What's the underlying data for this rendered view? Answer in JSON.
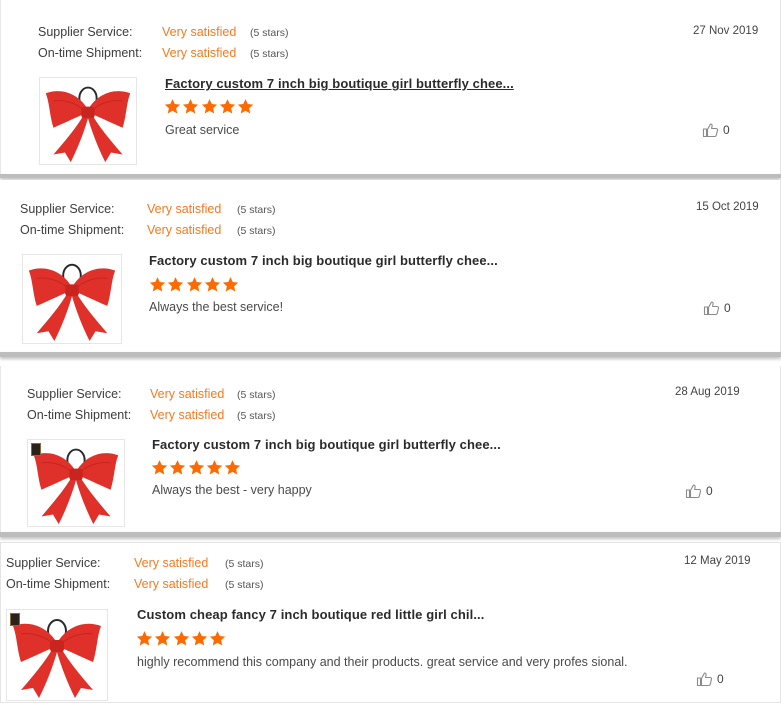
{
  "reviews": [
    {
      "supplier_label": "Supplier Service:",
      "supplier_value": "Very satisfied",
      "supplier_stars": "(5 stars)",
      "shipment_label": "On-time Shipment:",
      "shipment_value": "Very satisfied",
      "shipment_stars": "(5 stars)",
      "date": "27 Nov 2019",
      "product_title": "Factory custom 7 inch big boutique girl butterfly chee...",
      "rating": 5,
      "comment": "Great service",
      "likes": "0",
      "thumbnail_icon": "red-hair-bow-image"
    },
    {
      "supplier_label": "Supplier Service:",
      "supplier_value": "Very satisfied",
      "supplier_stars": "(5 stars)",
      "shipment_label": "On-time Shipment:",
      "shipment_value": "Very satisfied",
      "shipment_stars": "(5 stars)",
      "date": "15 Oct 2019",
      "product_title": "Factory custom 7 inch big boutique girl butterfly chee...",
      "rating": 5,
      "comment": "Always the best service!",
      "likes": "0",
      "thumbnail_icon": "red-hair-bow-image"
    },
    {
      "supplier_label": "Supplier Service:",
      "supplier_value": "Very satisfied",
      "supplier_stars": "(5 stars)",
      "shipment_label": "On-time Shipment:",
      "shipment_value": "Very satisfied",
      "shipment_stars": "(5 stars)",
      "date": "28 Aug 2019",
      "product_title": "Factory custom 7 inch big boutique girl butterfly chee...",
      "rating": 5,
      "comment": "Always the best - very happy",
      "likes": "0",
      "thumbnail_icon": "red-hair-bow-image"
    },
    {
      "supplier_label": "Supplier Service:",
      "supplier_value": "Very satisfied",
      "supplier_stars": "(5 stars)",
      "shipment_label": "On-time Shipment:",
      "shipment_value": "Very satisfied",
      "shipment_stars": "(5 stars)",
      "date": "12 May 2019",
      "product_title": "Custom cheap fancy 7 inch boutique red little girl chil...",
      "rating": 5,
      "comment": "highly recommend this company and their products. great service and very profes sional.",
      "likes": "0",
      "thumbnail_icon": "red-hair-bow-image"
    }
  ],
  "colors": {
    "accent_orange": "#f7791e",
    "star_orange": "#ff6a00",
    "bow_red": "#e0302a"
  }
}
